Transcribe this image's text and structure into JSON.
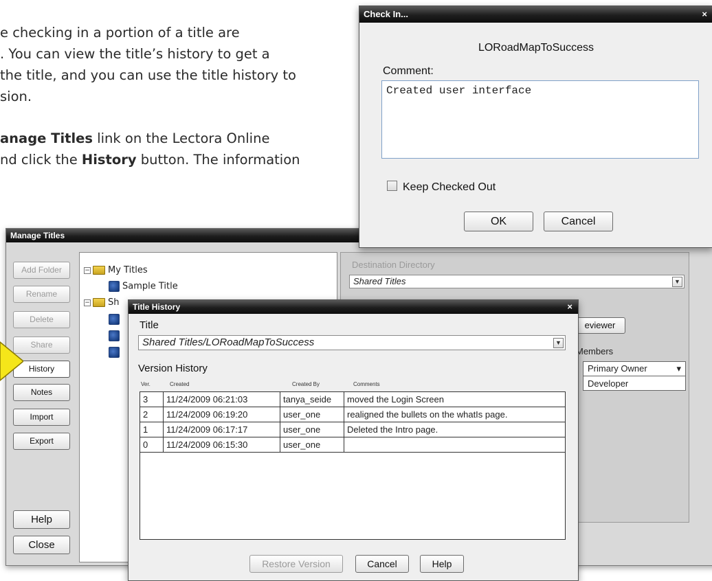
{
  "document": {
    "lines": [
      "e checking in a portion of a title are",
      ". You can view the title’s history to get a",
      " the title, and you can use the title history to",
      "sion."
    ],
    "line5_bold": "anage Titles",
    "line5_rest": " link on the Lectora Online",
    "line6_pre": "nd click the ",
    "line6_bold": "History",
    "line6_post": " button. The information"
  },
  "manage_titles": {
    "title": "Manage Titles",
    "buttons": {
      "add_folder": "Add Folder",
      "rename": "Rename",
      "delete": "Delete",
      "share": "Share",
      "history": "History",
      "notes": "Notes",
      "import": "Import",
      "export": "Export",
      "help": "Help",
      "close": "Close"
    },
    "tree": {
      "my_titles": "My Titles",
      "sample_title": "Sample Title",
      "shared_prefix": "Sh"
    },
    "destination_label": "Destination Directory",
    "destination_value": "Shared Titles",
    "reviewer_button": "eviewer",
    "members_label": "Members",
    "members": [
      {
        "role": "Primary Owner",
        "arrow": "▾"
      },
      {
        "role": "Developer",
        "arrow": ""
      }
    ]
  },
  "title_history": {
    "window_title": "Title History",
    "title_label": "Title",
    "title_value": "Shared Titles/LORoadMapToSuccess",
    "version_history_label": "Version History",
    "columns": {
      "ver": "Ver.",
      "created": "Created",
      "created_by": "Created By",
      "comments": "Comments"
    },
    "rows": [
      {
        "ver": "3",
        "created": "11/24/2009 06:21:03",
        "by": "tanya_seide",
        "comment": "moved the Login Screen"
      },
      {
        "ver": "2",
        "created": "11/24/2009 06:19:20",
        "by": "user_one",
        "comment": "realigned the bullets on the whatIs page."
      },
      {
        "ver": "1",
        "created": "11/24/2009 06:17:17",
        "by": "user_one",
        "comment": "Deleted the Intro page."
      },
      {
        "ver": "0",
        "created": "11/24/2009 06:15:30",
        "by": "user_one",
        "comment": ""
      }
    ],
    "restore_button": "Restore Version",
    "cancel_button": "Cancel",
    "help_button": "Help",
    "close_glyph": "×"
  },
  "check_in": {
    "window_title": "Check In...",
    "close_glyph": "×",
    "title_name": "LORoadMapToSuccess",
    "comment_label": "Comment:",
    "comment_value": "Created user interface",
    "keep_checked_out_label": "Keep Checked Out",
    "ok_button": "OK",
    "cancel_button": "Cancel"
  },
  "colors": {
    "callout_yellow": "#f5e61a",
    "titlebar_dark": "#151515"
  }
}
